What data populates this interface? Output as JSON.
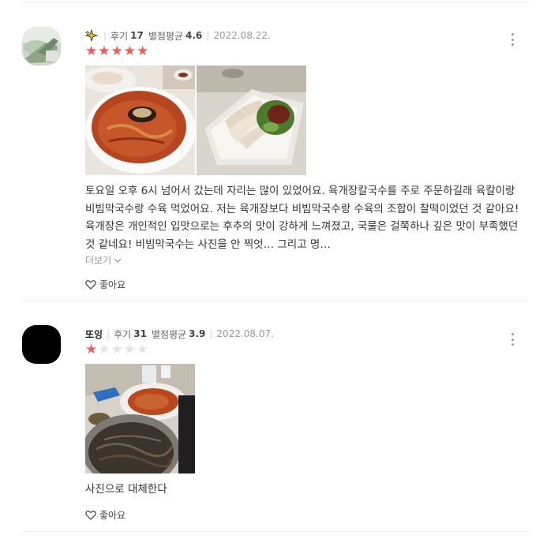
{
  "reviews": [
    {
      "nickname": "",
      "reviews_label": "후기",
      "reviews_count": "17",
      "avg_label": "별점평균",
      "avg_value": "4.6",
      "date": "2022.08.22.",
      "rating": 5,
      "text": "토요일 오후 6시 넘어서 갔는데 자리는 많이 있었어요. 육개장칼국수를 주로 주문하길래 육칼이랑 비빔막국수랑 수육 먹었어요. 저는 육개장보다 비빔막국수랑 수육의 조합이 찰떡이었던 것 같아요! 육개장은 개인적인 입맛으로는 후추의 맛이 강하게 느껴졌고, 국물은 걸쭉하나 깊은 맛이 부족했던 것 같네요! 비빔막국수는 사진을 안 찍엇… 그리고 명…",
      "more_label": "더보기",
      "like_label": "좋아요"
    },
    {
      "nickname": "또잉",
      "reviews_label": "후기",
      "reviews_count": "31",
      "avg_label": "별점평균",
      "avg_value": "3.9",
      "date": "2022.08.07.",
      "rating": 1,
      "text": "사진으로 대체한다",
      "like_label": "좋아요"
    }
  ],
  "colors": {
    "star_on": "#f25959",
    "star_off": "#e4e4e4"
  },
  "icons": [
    "user-avatar-icon",
    "sparkle-badge-icon",
    "kebab-menu-icon",
    "heart-icon",
    "chevron-down-icon"
  ]
}
